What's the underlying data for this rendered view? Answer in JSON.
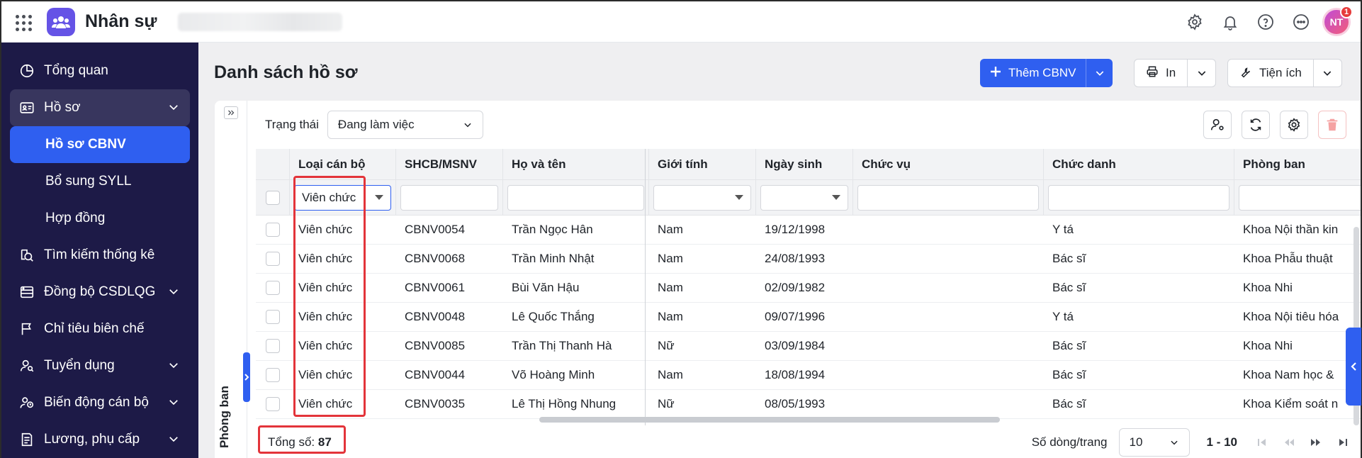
{
  "app": {
    "title": "Nhân sự",
    "user_initials": "NT",
    "notification_count": "1"
  },
  "sidebar": {
    "items": [
      {
        "label": "Tổng quan",
        "icon": "pie-chart-icon"
      },
      {
        "label": "Hồ sơ",
        "icon": "id-card-icon",
        "expanded": true
      },
      {
        "label": "Hồ sơ CBNV",
        "sub": true,
        "active": true
      },
      {
        "label": "Bổ sung SYLL",
        "sub": true
      },
      {
        "label": "Hợp đồng",
        "sub": true
      },
      {
        "label": "Tìm kiếm thống kê",
        "icon": "search-stats-icon"
      },
      {
        "label": "Đồng bộ CSDLQG",
        "icon": "sync-db-icon",
        "chevron": true
      },
      {
        "label": "Chỉ tiêu biên chế",
        "icon": "flag-icon"
      },
      {
        "label": "Tuyển dụng",
        "icon": "user-search-icon",
        "chevron": true
      },
      {
        "label": "Biến động cán bộ",
        "icon": "users-change-icon",
        "chevron": true
      },
      {
        "label": "Lương, phụ cấp",
        "icon": "salary-icon",
        "chevron": true
      }
    ]
  },
  "page": {
    "title": "Danh sách hồ sơ",
    "add_button": "Thêm CBNV",
    "print_button": "In",
    "utility_button": "Tiện ích"
  },
  "side_panel": {
    "label": "Phòng ban"
  },
  "filter": {
    "label": "Trạng thái",
    "value": "Đang làm việc"
  },
  "table": {
    "columns": [
      "Loại cán bộ",
      "SHCB/MSNV",
      "Họ và tên",
      "Giới tính",
      "Ngày sinh",
      "Chức vụ",
      "Chức danh",
      "Phòng ban"
    ],
    "filters": {
      "loai_can_bo": "Viên chức"
    },
    "rows": [
      {
        "loai": "Viên chức",
        "ma": "CBNV0054",
        "ten": "Trần Ngọc Hân",
        "gioi_tinh": "Nam",
        "ngay_sinh": "19/12/1998",
        "chuc_vu": "",
        "chuc_danh": "Y tá",
        "phong_ban": "Khoa Nội thần kin"
      },
      {
        "loai": "Viên chức",
        "ma": "CBNV0068",
        "ten": "Trần Minh Nhật",
        "gioi_tinh": "Nam",
        "ngay_sinh": "24/08/1993",
        "chuc_vu": "",
        "chuc_danh": "Bác sĩ",
        "phong_ban": "Khoa Phẫu thuật"
      },
      {
        "loai": "Viên chức",
        "ma": "CBNV0061",
        "ten": "Bùi Văn Hậu",
        "gioi_tinh": "Nam",
        "ngay_sinh": "02/09/1982",
        "chuc_vu": "",
        "chuc_danh": "Bác sĩ",
        "phong_ban": "Khoa Nhi"
      },
      {
        "loai": "Viên chức",
        "ma": "CBNV0048",
        "ten": "Lê Quốc Thắng",
        "gioi_tinh": "Nam",
        "ngay_sinh": "09/07/1996",
        "chuc_vu": "",
        "chuc_danh": "Y tá",
        "phong_ban": "Khoa Nội tiêu hóa"
      },
      {
        "loai": "Viên chức",
        "ma": "CBNV0085",
        "ten": "Trần Thị Thanh Hà",
        "gioi_tinh": "Nữ",
        "ngay_sinh": "03/09/1984",
        "chuc_vu": "",
        "chuc_danh": "Bác sĩ",
        "phong_ban": "Khoa Nhi"
      },
      {
        "loai": "Viên chức",
        "ma": "CBNV0044",
        "ten": "Võ Hoàng Minh",
        "gioi_tinh": "Nam",
        "ngay_sinh": "18/08/1994",
        "chuc_vu": "",
        "chuc_danh": "Bác sĩ",
        "phong_ban": "Khoa Nam học &"
      },
      {
        "loai": "Viên chức",
        "ma": "CBNV0035",
        "ten": "Lê Thị Hồng Nhung",
        "gioi_tinh": "Nữ",
        "ngay_sinh": "08/05/1993",
        "chuc_vu": "",
        "chuc_danh": "Bác sĩ",
        "phong_ban": "Khoa Kiểm soát n"
      }
    ]
  },
  "footer": {
    "total_label": "Tổng số:",
    "total_value": "87",
    "rows_per_page_label": "Số dòng/trang",
    "rows_per_page": "10",
    "range": "1 - 10"
  },
  "colors": {
    "primary": "#2f5ff0",
    "sidebar_bg": "#1d1a47",
    "highlight": "#e3343a"
  }
}
